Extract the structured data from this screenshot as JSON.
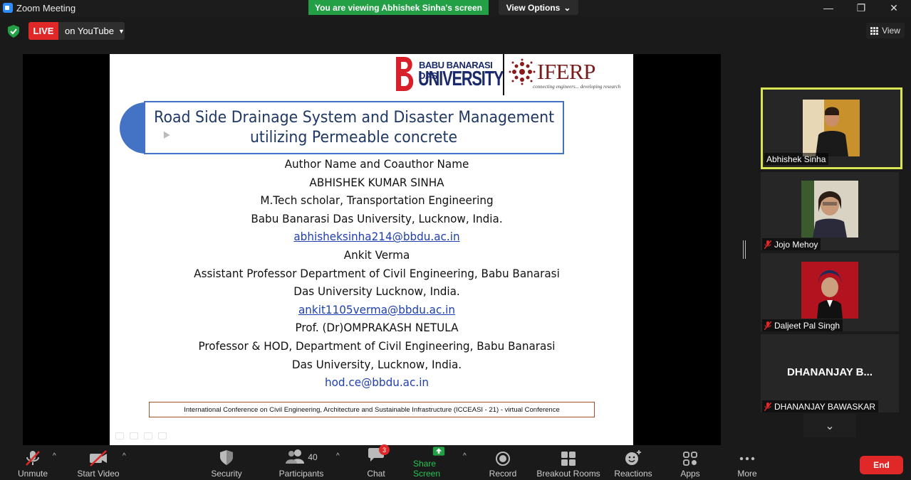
{
  "window": {
    "title": "Zoom Meeting",
    "viewing_banner": "You are viewing Abhishek Sinha's screen",
    "view_options": "View Options",
    "min": "—",
    "max": "❐",
    "close": "✕"
  },
  "top": {
    "live": "LIVE",
    "stream_target": "on YouTube",
    "view": "View"
  },
  "slide": {
    "bbd_line1": "BABU BANARASI DAS",
    "bbd_line2": "UNIVERSITY",
    "iferp_name": "IFERP",
    "iferp_tagline": "connecting engineers... developing research",
    "title_line1": "Road Side Drainage System and Disaster Management",
    "title_line2": "utilizing Permeable concrete",
    "lines": {
      "l1": "Author Name and Coauthor Name",
      "l2": "ABHISHEK KUMAR SINHA",
      "l3": "M.Tech scholar, Transportation Engineering",
      "l4": "Babu Banarasi Das University, Lucknow, India.",
      "l5": "abhisheksinha214@bbdu.ac.in",
      "l6": "Ankit Verma",
      "l7": "Assistant Professor Department of Civil Engineering, Babu Banarasi",
      "l8": "Das University Lucknow, India.",
      "l9": "ankit1105verma@bbdu.ac.in",
      "l10": "Prof. (Dr)OMPRAKASH NETULA",
      "l11": "Professor & HOD, Department of Civil Engineering, Babu Banarasi",
      "l12": "Das University, Lucknow, India.",
      "l13": "hod.ce@bbdu.ac.in"
    },
    "conference": "International Conference on Civil Engineering, Architecture and Sustainable Infrastructure (ICCEASI - 21) - virtual Conference"
  },
  "participants": [
    {
      "name": "Abhishek Sinha"
    },
    {
      "name": "Jojo Mehoy"
    },
    {
      "name": "Daljeet Pal Singh"
    },
    {
      "name": "DHANANJAY BAWASKAR",
      "initials": "DHANANJAY B..."
    }
  ],
  "toolbar": {
    "unmute": "Unmute",
    "start_video": "Start Video",
    "security": "Security",
    "participants": "Participants",
    "participants_count": "40",
    "chat": "Chat",
    "chat_badge": "3",
    "share_screen": "Share Screen",
    "record": "Record",
    "breakout_rooms": "Breakout Rooms",
    "reactions": "Reactions",
    "apps": "Apps",
    "more": "More",
    "end": "End"
  },
  "colors": {
    "live_red": "#e02828",
    "share_green": "#23a045",
    "active_speaker": "#d8e553",
    "slide_title": "#1f3864"
  }
}
